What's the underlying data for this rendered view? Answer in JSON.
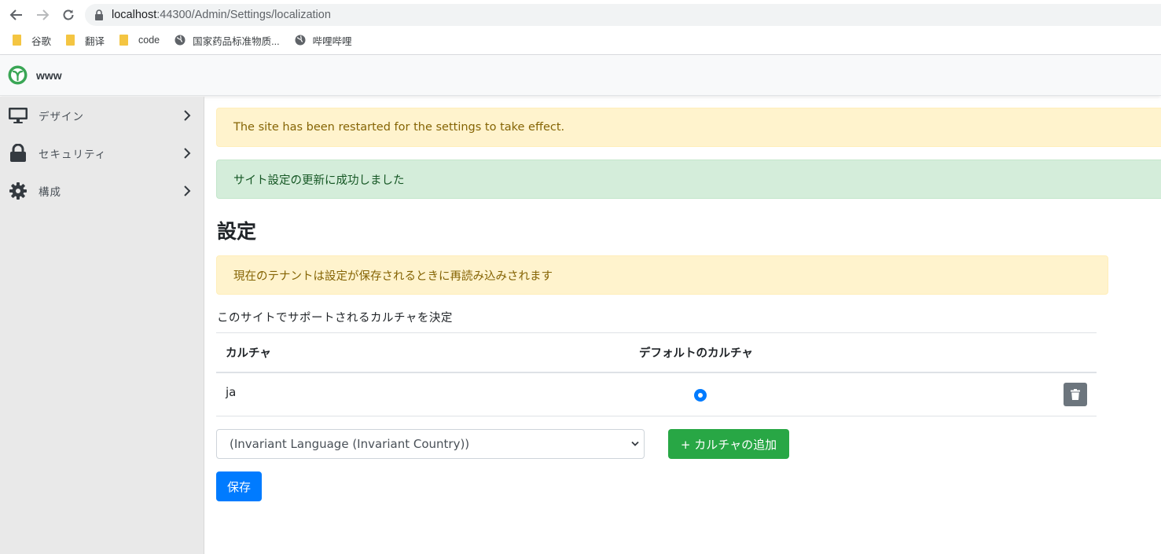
{
  "browser": {
    "url_host": "localhost",
    "url_path": ":44300/Admin/Settings/localization",
    "bookmarks": [
      {
        "label": "谷歌",
        "icon": "folder-icon"
      },
      {
        "label": "翻译",
        "icon": "folder-icon"
      },
      {
        "label": "code",
        "icon": "folder-icon"
      },
      {
        "label": "国家药品标准物质...",
        "icon": "globe-icon"
      },
      {
        "label": "哔哩哔哩",
        "icon": "globe-icon"
      }
    ]
  },
  "header": {
    "brand": "www"
  },
  "sidebar": {
    "items": [
      {
        "label": "デザイン",
        "icon": "monitor-icon"
      },
      {
        "label": "セキュリティ",
        "icon": "lock-icon"
      },
      {
        "label": "構成",
        "icon": "gear-icon"
      }
    ]
  },
  "alerts": {
    "restart": "The site has been restarted for the settings to take effect.",
    "success": "サイト設定の更新に成功しました",
    "tenant_reload": "現在のテナントは設定が保存されるときに再読み込みされます"
  },
  "page": {
    "title": "設定",
    "description": "このサイトでサポートされるカルチャを決定"
  },
  "table": {
    "headers": [
      "カルチャ",
      "デフォルトのカルチャ"
    ],
    "rows": [
      {
        "culture": "ja",
        "is_default": true
      }
    ]
  },
  "form": {
    "selected_culture": "(Invariant Language (Invariant Country))",
    "add_button": "+ カルチャの追加",
    "save_button": "保存"
  },
  "colors": {
    "primary": "#007bff",
    "success": "#28a745",
    "secondary": "#6c757d",
    "warning_bg": "#fff3cd",
    "success_bg": "#d4edda"
  }
}
